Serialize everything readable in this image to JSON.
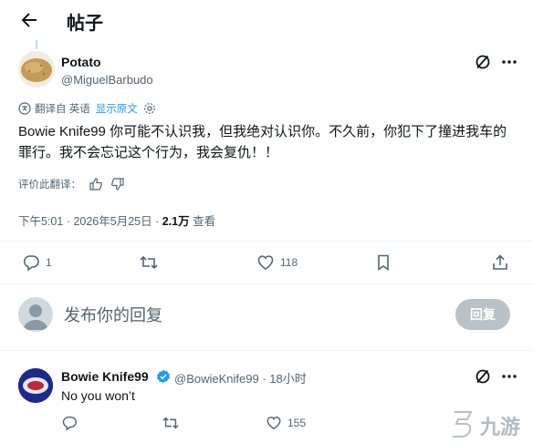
{
  "header": {
    "title": "帖子",
    "back_icon": "arrow-left-icon"
  },
  "post": {
    "author_name": "Potato",
    "author_handle": "@MiguelBarbudo",
    "translated_from": "翻译自 英语",
    "show_original": "显示原文",
    "text": "Bowie Knife99 你可能不认识我，但我绝对认识你。不久前，你犯下了撞进我车的罪行。我不会忘记这个行为，我会复仇！！",
    "rate_translation": "评价此翻译：",
    "time": "下午5:01",
    "date": "2026年5月25日",
    "views_count": "2.1万",
    "views_label": "查看",
    "separator": " · "
  },
  "actions": {
    "replies": "1",
    "retweets": "",
    "likes": "118"
  },
  "reply_box": {
    "placeholder": "发布你的回复",
    "button": "回复"
  },
  "reply": {
    "author_name": "Bowie Knife99",
    "author_handle": "@BowieKnife99",
    "time": "18小时",
    "separator": " · ",
    "text": "No you won’t",
    "replies": "",
    "retweets": "",
    "likes": "155"
  },
  "watermark": {
    "text": "九游"
  },
  "colors": {
    "accent": "#1d9bf0",
    "text": "#0f1419",
    "secondary": "#536471",
    "verified": "#1d9bf0"
  }
}
